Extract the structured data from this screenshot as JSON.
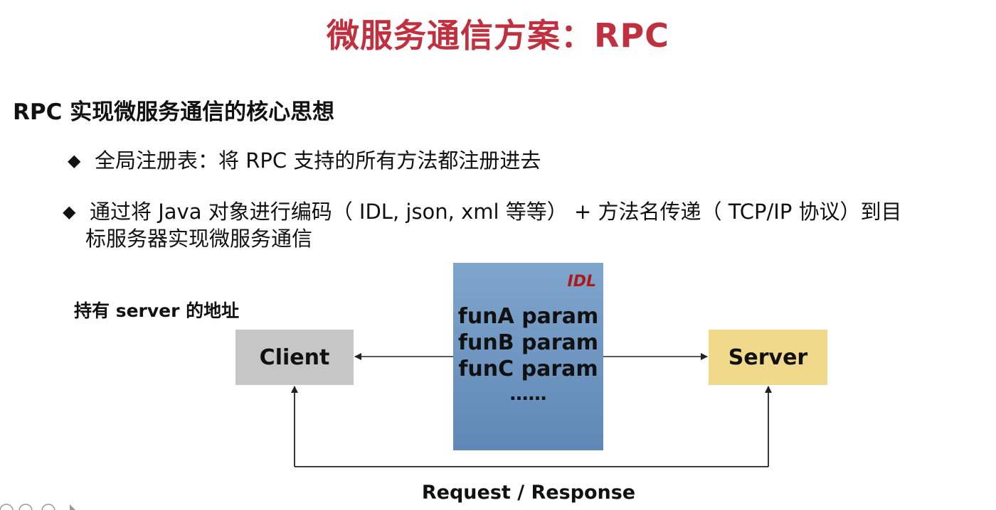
{
  "slide": {
    "title": "微服务通信方案：RPC",
    "heading": "RPC 实现微服务通信的核心思想",
    "bullets": [
      {
        "marker": "◆",
        "text": "全局注册表：将 RPC 支持的所有方法都注册进去"
      },
      {
        "marker": "◆",
        "text": "通过将 Java 对象进行编码（  IDL, json, xml 等等）  +  方法名传递（  TCP/IP 协议）到目",
        "continuation": "标服务器实现微服务通信"
      }
    ]
  },
  "diagram": {
    "address_label": "持有 server 的地址",
    "client_label": "Client",
    "server_label": "Server",
    "idl_tag": "IDL",
    "functions": [
      "funA param",
      "funB param",
      "funC param"
    ],
    "ellipsis": "……",
    "request_response_label": "Request / Response"
  },
  "colors": {
    "title": "#c0303f",
    "client_box": "#c6c6c6",
    "server_box": "#f0d98a",
    "idl_box": "#6f97c2",
    "idl_tag": "#b01818"
  }
}
